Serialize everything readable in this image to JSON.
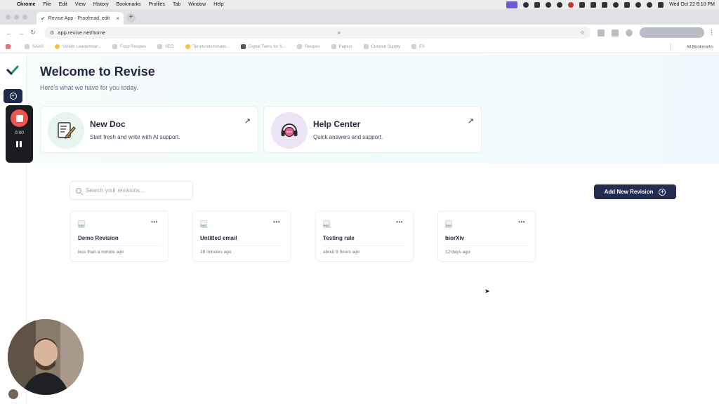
{
  "menubar": {
    "app": "Chrome",
    "items": [
      "File",
      "Edit",
      "View",
      "History",
      "Bookmarks",
      "Profiles",
      "Tab",
      "Window",
      "Help"
    ],
    "datetime": "Wed Oct 22  6:10 PM"
  },
  "browser": {
    "tab_title": "Revise App - Proofread, edit",
    "url": "app.revise.net/home",
    "bookmarks": [
      "SAAS",
      "Vidiots Leaderboar...",
      "Food Recipes",
      "SEO",
      "Tenetendommatis...",
      "Digital Twins for S...",
      "Recipes",
      "Papers",
      "Curated Supply",
      "ES"
    ],
    "all_bookmarks": "All Bookmarks"
  },
  "recorder": {
    "time": "0:00"
  },
  "hero": {
    "title": "Welcome to Revise",
    "subtitle": "Here's what we have for you today."
  },
  "cards": [
    {
      "title": "New Doc",
      "desc": "Start fresh and write with AI support."
    },
    {
      "title": "Help Center",
      "desc": "Quick answers and support."
    }
  ],
  "search": {
    "placeholder": "Search your revisions..."
  },
  "add_button": "Add New Revision",
  "documents": [
    {
      "icon_label": "DOC",
      "name": "Demo Revision",
      "time": "less than a minute ago"
    },
    {
      "icon_label": "DOC",
      "name": "Untitled email",
      "time": "28 minutes ago"
    },
    {
      "icon_label": "DOC",
      "name": "Testing rule",
      "time": "about 9 hours ago"
    },
    {
      "icon_label": "DOC",
      "name": "biorXiv",
      "time": "12 days ago"
    }
  ],
  "colors": {
    "primary": "#232b4e",
    "accent_green": "#2a8f72",
    "record_red": "#ef5350",
    "hero_bg": "#f2fbfd"
  }
}
